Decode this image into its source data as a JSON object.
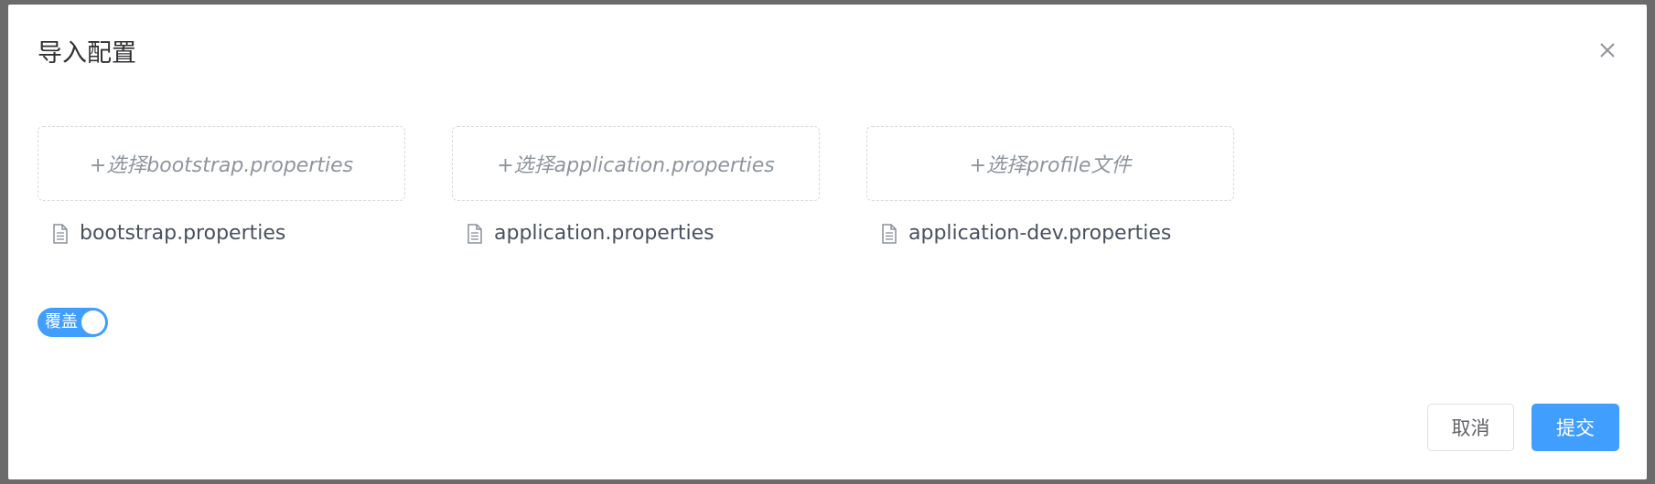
{
  "dialog": {
    "title": "导入配置"
  },
  "uploads": [
    {
      "button_label": "+选择bootstrap.properties",
      "file_name": "bootstrap.properties"
    },
    {
      "button_label": "+选择application.properties",
      "file_name": "application.properties"
    },
    {
      "button_label": "+选择profile文件",
      "file_name": "application-dev.properties"
    }
  ],
  "overwrite_switch": {
    "label": "覆盖",
    "checked": true
  },
  "footer": {
    "cancel_label": "取消",
    "submit_label": "提交"
  },
  "colors": {
    "primary": "#409eff",
    "placeholder_text": "#8f959e",
    "title_text": "#303133"
  },
  "icons": {
    "close": "close-icon",
    "file": "document-icon"
  }
}
